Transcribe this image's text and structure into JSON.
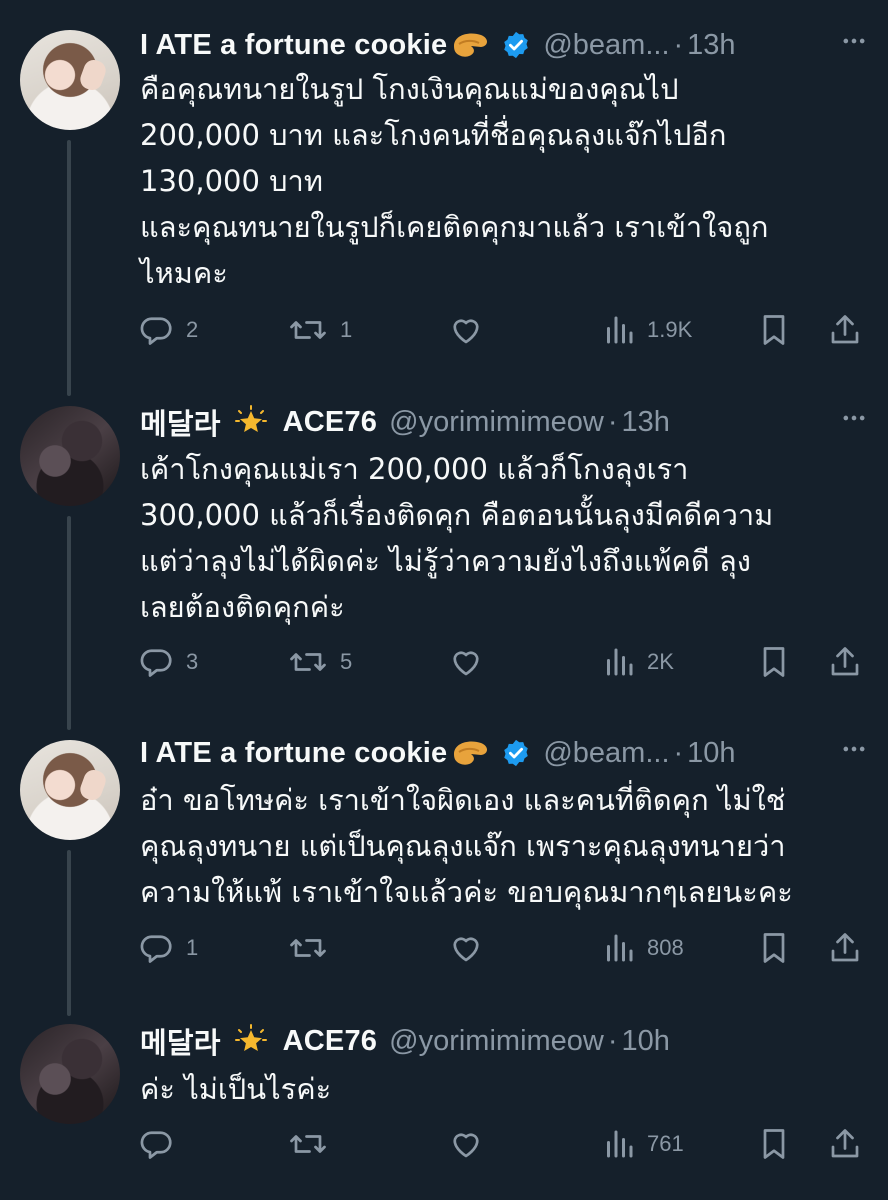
{
  "tweets": [
    {
      "name": "I ATE a fortune cookie",
      "name_emoji": "fortune-cookie-emoji",
      "verified": true,
      "handle": "@beam...",
      "separator": "·",
      "time": "13h",
      "lines": [
        "คือคุณทนายในรูป โกงเงินคุณแม่ของคุณไป",
        "200,000 บาท และโกงคนที่ชื่อคุณลุงแจ๊กไปอีก",
        "130,000 บาท",
        "และคุณทนายในรูปก็เคยติดคุกมาแล้ว เราเข้าใจถูก",
        "ไหมคะ"
      ],
      "replies": "2",
      "reposts": "1",
      "views": "1.9K"
    },
    {
      "name": "메달라",
      "name_suffix": "ACE76",
      "name_emoji": "glowing-star-emoji",
      "verified": false,
      "handle": "@yorimimimeow",
      "separator": "·",
      "time": "13h",
      "lines": [
        "เค้าโกงคุณแม่เรา 200,000 แล้วก็โกงลุงเรา",
        "300,000 แล้วก็เรื่องติดคุก คือตอนนั้นลุงมีคดีความ",
        "แต่ว่าลุงไม่ได้ผิดค่ะ ไม่รู้ว่าความยังไงถึงแพ้คดี ลุง",
        "เลยต้องติดคุกค่ะ"
      ],
      "replies": "3",
      "reposts": "5",
      "views": "2K"
    },
    {
      "name": "I ATE a fortune cookie",
      "name_emoji": "fortune-cookie-emoji",
      "verified": true,
      "handle": "@beam...",
      "separator": "·",
      "time": "10h",
      "lines": [
        "อ๋า ขอโทษค่ะ เราเข้าใจผิดเอง และคนที่ติดคุก ไม่ใช่",
        "คุณลุงทนาย แต่เป็นคุณลุงแจ๊ก เพราะคุณลุงทนายว่า",
        "ความให้แพ้ เราเข้าใจแล้วค่ะ ขอบคุณมากๆเลยนะคะ"
      ],
      "replies": "1",
      "reposts": "",
      "views": "808"
    },
    {
      "name": "메달라",
      "name_suffix": "ACE76",
      "name_emoji": "glowing-star-emoji",
      "verified": false,
      "handle": "@yorimimimeow",
      "separator": "·",
      "time": "10h",
      "lines": [
        "ค่ะ ไม่เป็นไรค่ะ"
      ],
      "replies": "",
      "reposts": "",
      "views": "761"
    }
  ],
  "colors": {
    "background": "#15202b",
    "text": "#f7f9f9",
    "muted": "#8b98a5",
    "verified": "#1d9bf0",
    "thread_line": "#38444d"
  }
}
